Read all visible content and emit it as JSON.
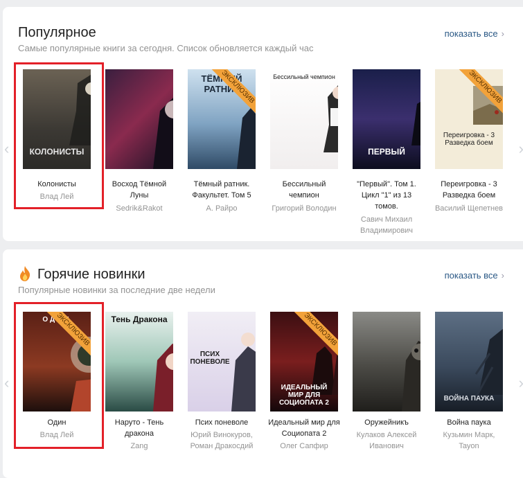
{
  "popular": {
    "title": "Популярное",
    "subtitle": "Самые популярные книги за сегодня. Список обновляется каждый час",
    "show_all": "показать все",
    "books": [
      {
        "title_lines": [
          "Колонисты"
        ],
        "author_lines": [
          "Влад Лей"
        ],
        "cover_text": "КОЛОНИСТЫ",
        "exclusive": false,
        "highlighted": true
      },
      {
        "title_lines": [
          "Восход Тёмной",
          "Луны"
        ],
        "author_lines": [
          "Sedrik&Rakot"
        ],
        "cover_text": "",
        "exclusive": false,
        "highlighted": false
      },
      {
        "title_lines": [
          "Тёмный ратник.",
          "Факультет. Том 5"
        ],
        "author_lines": [
          "А. Райро"
        ],
        "cover_text": "ТЁМНЫЙ РАТНИК",
        "exclusive": true,
        "highlighted": false
      },
      {
        "title_lines": [
          "Бессильный",
          "чемпион"
        ],
        "author_lines": [
          "Григорий Володин"
        ],
        "cover_text": "Бессильный чемпион",
        "exclusive": false,
        "highlighted": false
      },
      {
        "title_lines": [
          "\"Первый\". Том 1.",
          "Цикл \"1\" из 13",
          "томов."
        ],
        "author_lines": [
          "Савич Михаил",
          "Владимирович"
        ],
        "cover_text": "ПЕРВЫЙ",
        "exclusive": false,
        "highlighted": false
      },
      {
        "title_lines": [
          "Переигровка - 3",
          "Разведка боем"
        ],
        "author_lines": [
          "Василий Щепетнев"
        ],
        "cover_text": "Переигровка - 3 Разведка боем",
        "exclusive": true,
        "highlighted": false
      }
    ]
  },
  "hot": {
    "title": "Горячие новинки",
    "subtitle": "Популярные новинки за последние две недели",
    "show_all": "показать все",
    "books": [
      {
        "title_lines": [
          "Один"
        ],
        "author_lines": [
          "Влад Лей"
        ],
        "cover_text": "ОДИН",
        "exclusive": true,
        "highlighted": true
      },
      {
        "title_lines": [
          "Наруто - Тень",
          "дракона"
        ],
        "author_lines": [
          "Zang"
        ],
        "cover_text": "Тень Дракона",
        "exclusive": false,
        "highlighted": false
      },
      {
        "title_lines": [
          "Псих поневоле"
        ],
        "author_lines": [
          "Юрий Винокуров,",
          "Роман Дракосдий"
        ],
        "cover_text": "ПСИХ ПОНЕВОЛЕ",
        "exclusive": false,
        "highlighted": false
      },
      {
        "title_lines": [
          "Идеальный мир для",
          "Социопата 2"
        ],
        "author_lines": [
          "Олег Сапфир"
        ],
        "cover_text": "ИДЕАЛЬНЫЙ МИР ДЛЯ СОЦИОПАТА 2",
        "exclusive": true,
        "highlighted": false
      },
      {
        "title_lines": [
          "Оружейникъ"
        ],
        "author_lines": [
          "Кулаков Алексей",
          "Иванович"
        ],
        "cover_text": "",
        "exclusive": false,
        "highlighted": false
      },
      {
        "title_lines": [
          "Война паука"
        ],
        "author_lines": [
          "Кузьмин Марк,",
          "Tayon"
        ],
        "cover_text": "ВОЙНА ПАУКА",
        "exclusive": false,
        "highlighted": false
      }
    ]
  },
  "exclusive_label": "ЭКСКЛЮЗИВ",
  "colors": {
    "accent_link": "#2a5885",
    "highlight": "#e32028",
    "exclusive_ribbon": "#f2a23a"
  }
}
